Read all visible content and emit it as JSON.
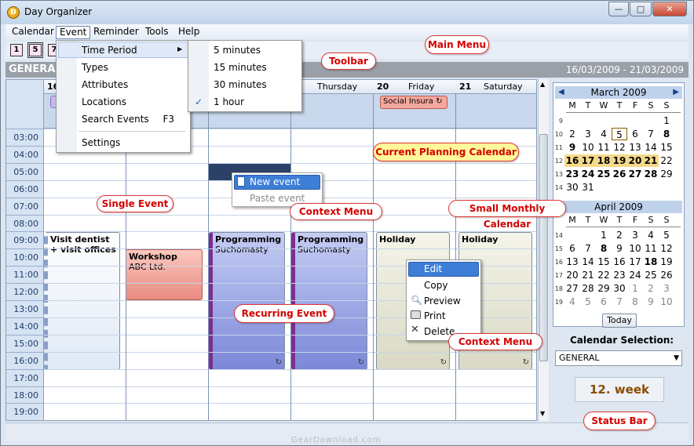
{
  "window": {
    "title": "Day Organizer",
    "minimize": "—",
    "maximize": "□",
    "close": "✕"
  },
  "menubar": [
    "Calendar",
    "Event",
    "Reminder",
    "Tools",
    "Help"
  ],
  "toolbar": {
    "buttons": [
      "1",
      "5",
      "7"
    ]
  },
  "planbar": {
    "calendar": "GENERA",
    "date_range": "16/03/2009 - 21/03/2009"
  },
  "days": [
    {
      "num": "16",
      "name": ""
    },
    {
      "num": "",
      "name": ""
    },
    {
      "num": "",
      "name": ""
    },
    {
      "num": "",
      "name": "Thursday"
    },
    {
      "num": "20",
      "name": "Friday"
    },
    {
      "num": "21",
      "name": "Saturday"
    }
  ],
  "hours": [
    "03:00",
    "04:00",
    "05:00",
    "06:00",
    "07:00",
    "08:00",
    "09:00",
    "10:00",
    "11:00",
    "12:00",
    "13:00",
    "14:00",
    "15:00",
    "16:00",
    "17:00",
    "18:00",
    "19:00"
  ],
  "allday_events": [
    {
      "title": "Social Insura"
    }
  ],
  "events": [
    {
      "title": "Visit dentist + visit offices",
      "sub": ""
    },
    {
      "title": "Workshop",
      "sub": "ABC Ltd."
    },
    {
      "title": "Programming",
      "sub": "Suchomasty"
    },
    {
      "title": "Programming",
      "sub": "Suchomasty"
    },
    {
      "title": "Holiday",
      "sub": ""
    },
    {
      "title": "Holiday",
      "sub": ""
    }
  ],
  "event_menu": {
    "items": [
      "Time Period",
      "Types",
      "Attributes",
      "Locations",
      "Search Events",
      "Settings"
    ],
    "search_shortcut": "F3"
  },
  "time_period_menu": {
    "items": [
      "5 minutes",
      "15 minutes",
      "30 minutes",
      "1 hour"
    ],
    "checked": "✓"
  },
  "context_menu_small": {
    "items": [
      "New event",
      "Paste event"
    ]
  },
  "context_menu_event": {
    "items": [
      "Edit",
      "Copy",
      "Preview",
      "Print",
      "Delete"
    ]
  },
  "minical": {
    "march": {
      "title": "March 2009",
      "dow": [
        "M",
        "T",
        "W",
        "T",
        "F",
        "S",
        "S"
      ],
      "weeks": [
        {
          "wk": "9",
          "days": [
            "",
            "",
            "",
            "",
            "",
            "",
            "1"
          ]
        },
        {
          "wk": "10",
          "days": [
            "2",
            "3",
            "4",
            "5",
            "6",
            "7",
            "8"
          ]
        },
        {
          "wk": "11",
          "days": [
            "9",
            "10",
            "11",
            "12",
            "13",
            "14",
            "15"
          ]
        },
        {
          "wk": "12",
          "days": [
            "16",
            "17",
            "18",
            "19",
            "20",
            "21",
            "22"
          ]
        },
        {
          "wk": "13",
          "days": [
            "23",
            "24",
            "25",
            "26",
            "27",
            "28",
            "29"
          ]
        },
        {
          "wk": "14",
          "days": [
            "30",
            "31",
            "",
            "",
            "",
            "",
            ""
          ]
        }
      ]
    },
    "april": {
      "title": "April 2009",
      "dow": [
        "M",
        "T",
        "W",
        "T",
        "F",
        "S",
        "S"
      ],
      "weeks": [
        {
          "wk": "14",
          "days": [
            "",
            "",
            "1",
            "2",
            "3",
            "4",
            "5"
          ]
        },
        {
          "wk": "15",
          "days": [
            "6",
            "7",
            "8",
            "9",
            "10",
            "11",
            "12"
          ]
        },
        {
          "wk": "16",
          "days": [
            "13",
            "14",
            "15",
            "16",
            "17",
            "18",
            "19"
          ]
        },
        {
          "wk": "17",
          "days": [
            "20",
            "21",
            "22",
            "23",
            "24",
            "25",
            "26"
          ]
        },
        {
          "wk": "18",
          "days": [
            "27",
            "28",
            "29",
            "30",
            "1",
            "2",
            "3"
          ]
        },
        {
          "wk": "19",
          "days": [
            "4",
            "5",
            "6",
            "7",
            "8",
            "9",
            "10"
          ]
        }
      ]
    },
    "today": "Today"
  },
  "sidepanel": {
    "selection_label": "Calendar Selection:",
    "selected_calendar": "GENERAL",
    "week": "12. week"
  },
  "callouts": [
    "Main Menu",
    "Toolbar",
    "Current Planning Calendar",
    "Single Event",
    "Context Menu",
    "Small Monthly Calendar",
    "Recurring Event",
    "Context Menu",
    "Status Bar"
  ],
  "watermark": "GearDownload.com"
}
